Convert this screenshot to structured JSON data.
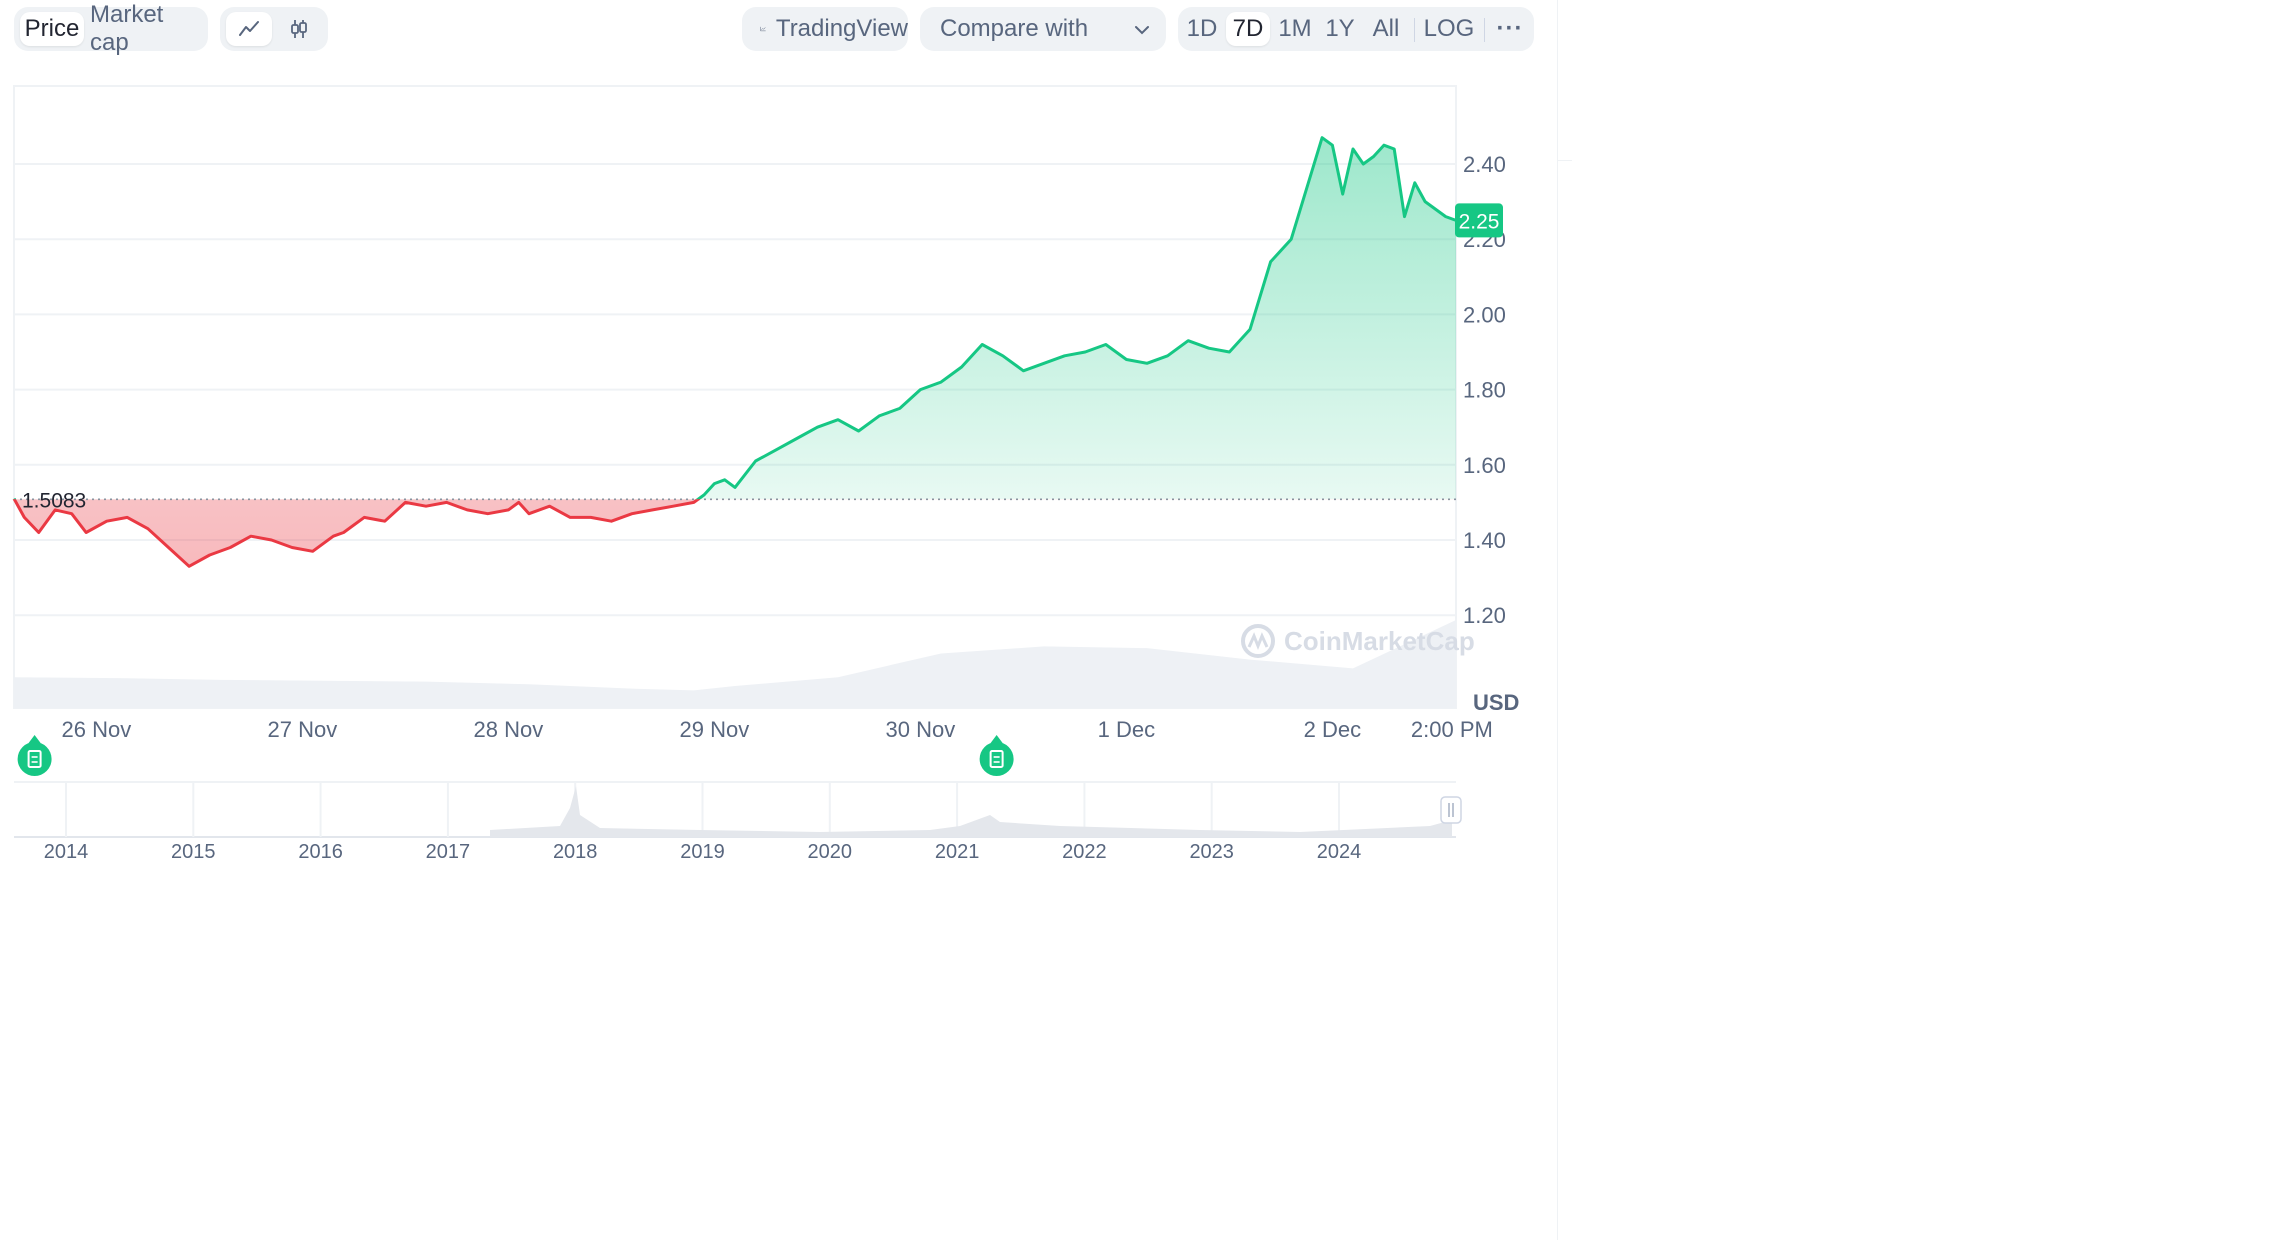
{
  "toolbar": {
    "view_tabs": [
      {
        "label": "Price",
        "active": true
      },
      {
        "label": "Market cap",
        "active": false
      }
    ],
    "chart_types": [
      {
        "icon": "line-chart-icon",
        "active": true
      },
      {
        "icon": "candlestick-icon",
        "active": false
      }
    ],
    "tradingview_label": "TradingView",
    "compare_label": "Compare with",
    "ranges": [
      {
        "label": "1D",
        "active": false
      },
      {
        "label": "7D",
        "active": true
      },
      {
        "label": "1M",
        "active": false
      },
      {
        "label": "1Y",
        "active": false
      },
      {
        "label": "All",
        "active": false
      }
    ],
    "log_label": "LOG",
    "more_label": "···"
  },
  "colors": {
    "up": "#16c784",
    "down": "#ea3943",
    "grid": "#eff2f5",
    "text": "#58667e"
  },
  "chart_data": {
    "type": "area",
    "title": "",
    "xlabel": "",
    "ylabel": "",
    "currency_label": "USD",
    "watermark": "CoinMarketCap",
    "reference_value": 1.5083,
    "reference_label": "1.5083",
    "current_value": 2.25,
    "current_label": "2.25",
    "ylim": [
      1.0,
      2.6
    ],
    "y_ticks": [
      {
        "value": 1.2,
        "label": "1.20"
      },
      {
        "value": 1.4,
        "label": "1.40"
      },
      {
        "value": 1.6,
        "label": "1.60"
      },
      {
        "value": 1.8,
        "label": "1.80"
      },
      {
        "value": 2.0,
        "label": "2.00"
      },
      {
        "value": 2.2,
        "label": "2.20"
      },
      {
        "value": 2.4,
        "label": "2.40"
      }
    ],
    "x_range_days": [
      0,
      7
    ],
    "x_ticks": [
      {
        "day": 0.4,
        "label": "26 Nov"
      },
      {
        "day": 1.4,
        "label": "27 Nov"
      },
      {
        "day": 2.4,
        "label": "28 Nov"
      },
      {
        "day": 3.4,
        "label": "29 Nov"
      },
      {
        "day": 4.4,
        "label": "30 Nov"
      },
      {
        "day": 5.4,
        "label": "1 Dec"
      },
      {
        "day": 6.4,
        "label": "2 Dec"
      },
      {
        "day": 6.98,
        "label": "2:00 PM"
      }
    ],
    "series": [
      {
        "x": [
          0,
          0.05,
          0.12,
          0.2,
          0.28,
          0.35,
          0.45,
          0.55,
          0.65,
          0.75,
          0.85,
          0.95,
          1.05,
          1.15,
          1.25,
          1.35,
          1.45,
          1.55,
          1.6,
          1.7,
          1.8,
          1.9,
          2.0,
          2.1,
          2.2,
          2.3,
          2.4,
          2.45,
          2.5,
          2.6,
          2.7,
          2.8,
          2.9,
          3.0,
          3.1,
          3.2,
          3.3,
          3.35,
          3.4,
          3.45,
          3.5,
          3.6,
          3.7,
          3.8,
          3.9,
          4.0,
          4.1,
          4.2,
          4.3,
          4.4,
          4.5,
          4.6,
          4.7,
          4.8,
          4.9,
          5.0,
          5.1,
          5.2,
          5.3,
          5.4,
          5.5,
          5.6,
          5.7,
          5.8,
          5.9,
          6.0,
          6.1,
          6.2,
          6.3,
          6.35,
          6.4,
          6.45,
          6.5,
          6.55,
          6.6,
          6.65,
          6.7,
          6.75,
          6.8,
          6.85,
          6.9,
          6.95,
          7.0
        ],
        "y": [
          1.51,
          1.46,
          1.42,
          1.48,
          1.47,
          1.42,
          1.45,
          1.46,
          1.43,
          1.38,
          1.33,
          1.36,
          1.38,
          1.41,
          1.4,
          1.38,
          1.37,
          1.41,
          1.42,
          1.46,
          1.45,
          1.5,
          1.49,
          1.5,
          1.48,
          1.47,
          1.48,
          1.5,
          1.47,
          1.49,
          1.46,
          1.46,
          1.45,
          1.47,
          1.48,
          1.49,
          1.5,
          1.52,
          1.55,
          1.56,
          1.54,
          1.61,
          1.64,
          1.67,
          1.7,
          1.72,
          1.69,
          1.73,
          1.75,
          1.8,
          1.82,
          1.86,
          1.92,
          1.89,
          1.85,
          1.87,
          1.89,
          1.9,
          1.92,
          1.88,
          1.87,
          1.89,
          1.93,
          1.91,
          1.9,
          1.96,
          2.14,
          2.2,
          2.38,
          2.47,
          2.45,
          2.32,
          2.44,
          2.4,
          2.42,
          2.45,
          2.44,
          2.26,
          2.35,
          2.3,
          2.28,
          2.26,
          2.25
        ]
      }
    ],
    "volume": {
      "x": [
        0,
        0.5,
        1.0,
        1.5,
        2.0,
        2.5,
        3.0,
        3.3,
        3.5,
        4.0,
        4.5,
        5.0,
        5.5,
        6.0,
        6.5,
        7.0
      ],
      "values": [
        0.35,
        0.34,
        0.32,
        0.31,
        0.3,
        0.27,
        0.22,
        0.2,
        0.25,
        0.35,
        0.62,
        0.7,
        0.68,
        0.55,
        0.45,
        1.0
      ]
    },
    "overview": {
      "year_labels": [
        "2014",
        "2015",
        "2016",
        "2017",
        "2018",
        "2019",
        "2020",
        "2021",
        "2022",
        "2023",
        "2024"
      ]
    }
  },
  "events": [
    {
      "icon": "document-icon",
      "day": 0.1
    },
    {
      "icon": "document-icon",
      "day": 4.77
    }
  ]
}
